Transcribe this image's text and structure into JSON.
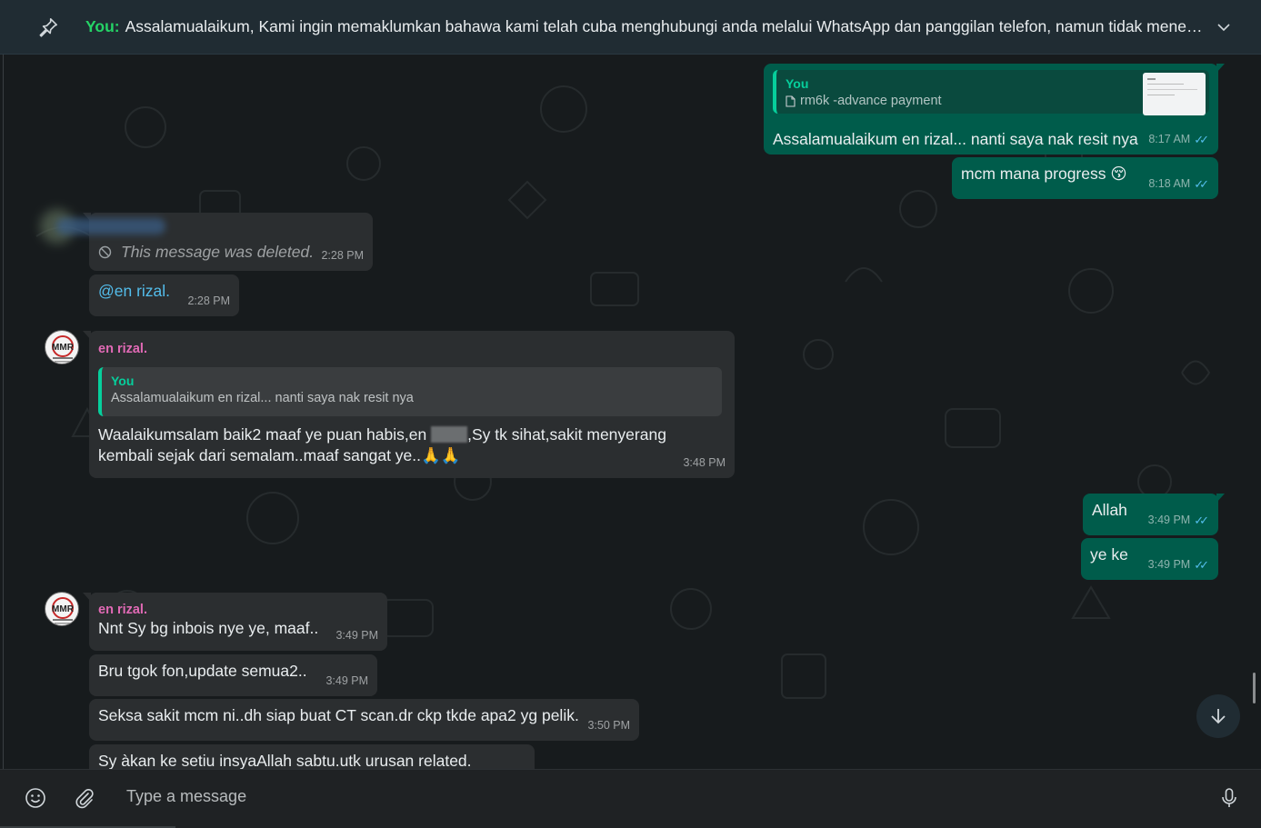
{
  "pinned": {
    "sender": "You:",
    "text": "Assalamualaikum,  Kami ingin memaklumkan bahawa kami telah cuba menghubungi anda melalui WhatsApp dan panggilan telefon, namun tidak mener…"
  },
  "messages": {
    "m1": {
      "quote_name": "You",
      "quote_doc": "rm6k -advance payment",
      "text": "Assalamualaikum en rizal... nanti saya nak resit nya",
      "time": "8:17 AM"
    },
    "m2": {
      "text": "mcm mana progress 😚",
      "time": "8:18 AM"
    },
    "m3": {
      "text": "This message was deleted.",
      "time": "2:28 PM"
    },
    "m4": {
      "text": "@en rizal.",
      "time": "2:28 PM"
    },
    "m5": {
      "sender": "en rizal.",
      "quote_name": "You",
      "quote_text": "Assalamualaikum en rizal... nanti saya nak resit nya",
      "text_a": "Waalaikumsalam baik2 maaf ye puan habis,en ",
      "text_b": ",Sy tk sihat,sakit menyerang kembali sejak dari semalam..maaf sangat ye..🙏🙏",
      "time": "3:48 PM"
    },
    "m6": {
      "text": "Allah",
      "time": "3:49 PM"
    },
    "m7": {
      "text": "ye ke",
      "time": "3:49 PM"
    },
    "m8": {
      "sender": "en rizal.",
      "text": "Nnt Sy bg inbois nye ye, maaf..",
      "time": "3:49 PM"
    },
    "m9": {
      "text": "Bru tgok fon,update semua2..",
      "time": "3:49 PM"
    },
    "m10": {
      "text": "Seksa sakit mcm ni..dh siap buat CT scan.dr ckp tkde apa2 yg pelik.",
      "time": "3:50 PM"
    },
    "m11": {
      "text": "Sy àkan ke setiu insyaAllah sabtu.utk urusan related."
    }
  },
  "avatar_text": "MMR",
  "composer": {
    "placeholder": "Type a message"
  },
  "icons": [
    "pin-icon",
    "chevron-down-icon",
    "document-icon",
    "blocked-icon",
    "double-check-icon",
    "arrow-down-icon",
    "emoji-icon",
    "attach-icon",
    "mic-icon"
  ],
  "colors": {
    "outgoing": "#005c4b",
    "incoming": "#2b2e30",
    "accent": "#06cf9c",
    "sender_name": "#e26ab6",
    "ticks": "#53bdeb"
  }
}
